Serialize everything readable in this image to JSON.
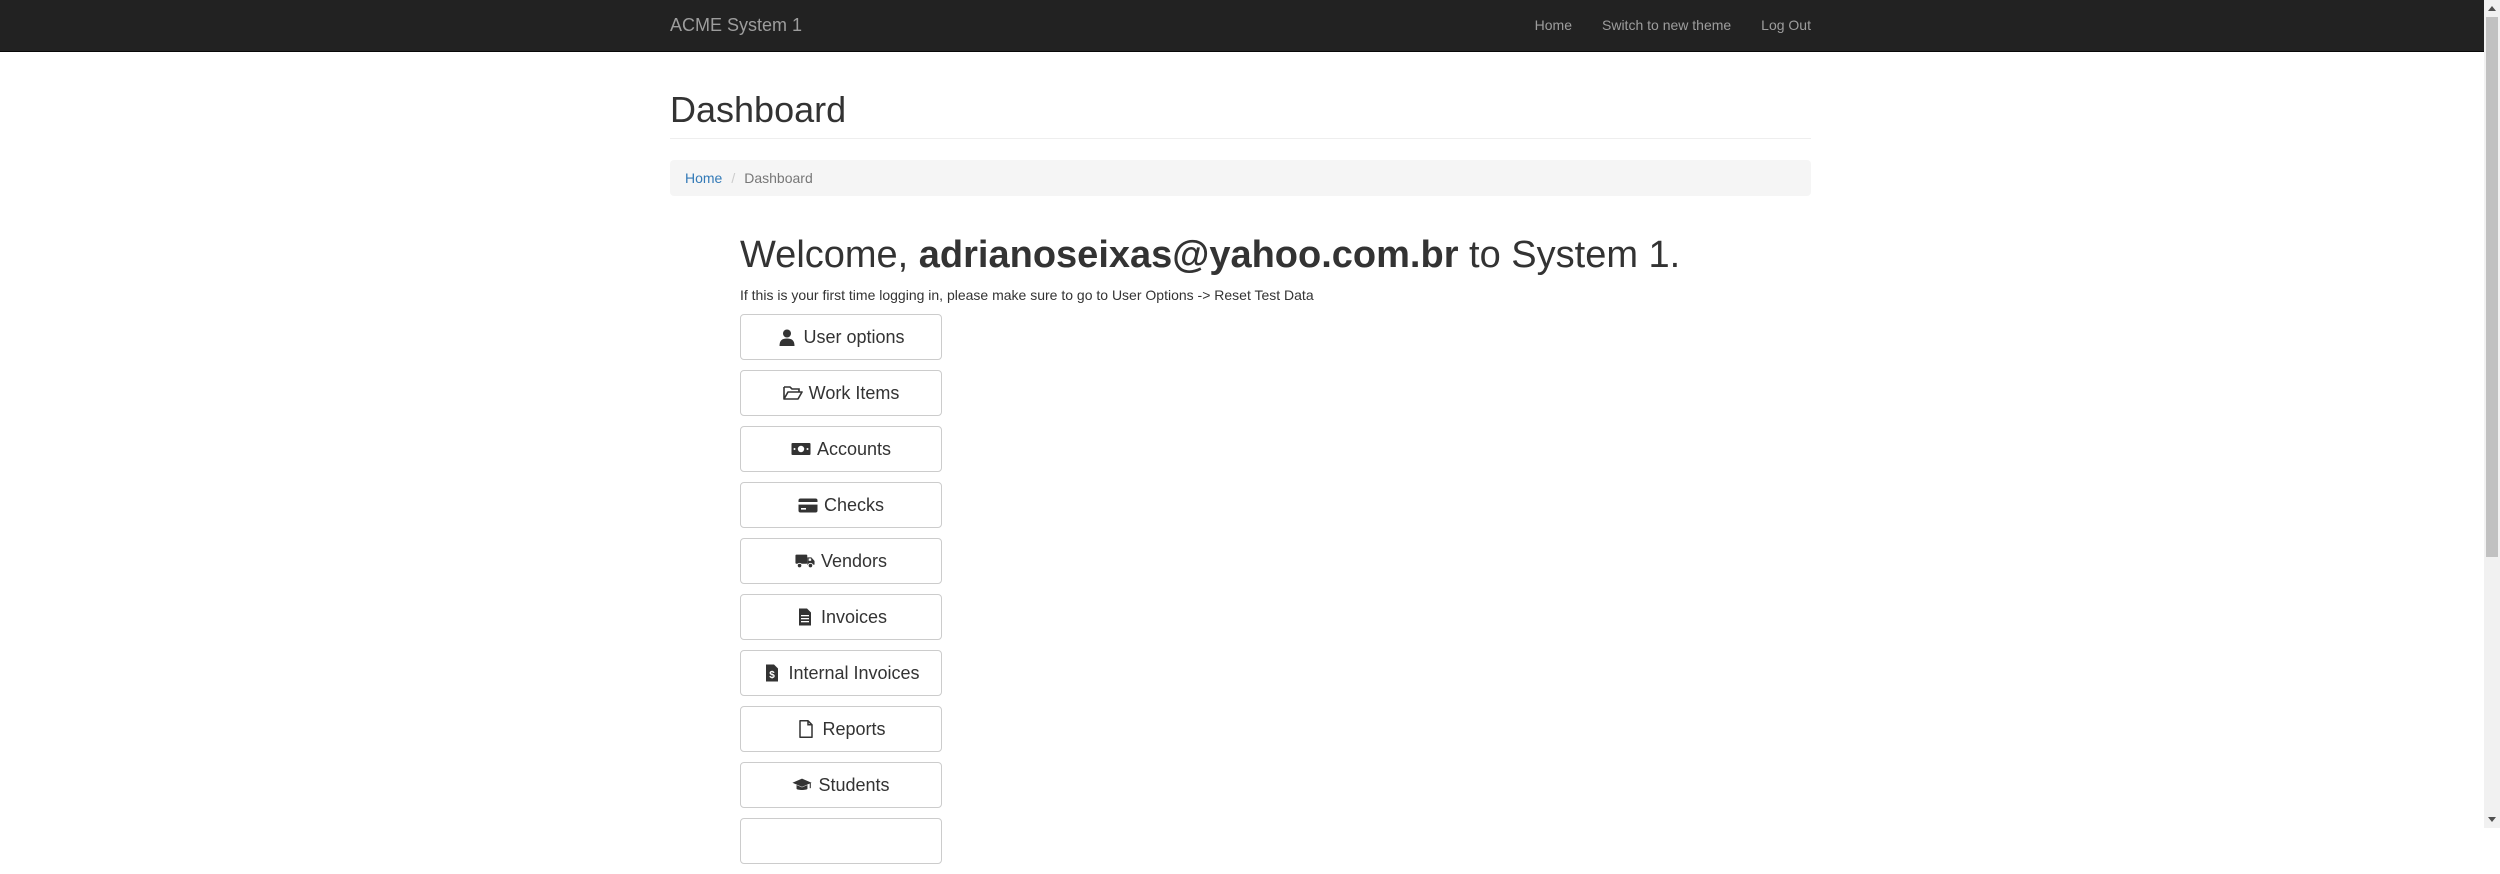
{
  "navbar": {
    "brand": "ACME System 1",
    "links": [
      "Home",
      "Switch to new theme",
      "Log Out"
    ]
  },
  "page": {
    "title": "Dashboard"
  },
  "breadcrumb": {
    "home": "Home",
    "separator": "/",
    "current": "Dashboard"
  },
  "welcome": {
    "prefix": "Welcome, ",
    "email": "adrianoseixas@yahoo.com.br",
    "suffix": " to System 1."
  },
  "note": "If this is your first time logging in, please make sure to go to User Options -> Reset Test Data",
  "menu": [
    {
      "label": "User options",
      "icon": "user-icon"
    },
    {
      "label": "Work Items",
      "icon": "folder-open-icon"
    },
    {
      "label": "Accounts",
      "icon": "money-icon"
    },
    {
      "label": "Checks",
      "icon": "credit-card-icon"
    },
    {
      "label": "Vendors",
      "icon": "truck-icon"
    },
    {
      "label": "Invoices",
      "icon": "file-text-icon"
    },
    {
      "label": "Internal Invoices",
      "icon": "file-invoice-icon"
    },
    {
      "label": "Reports",
      "icon": "file-icon"
    },
    {
      "label": "Students",
      "icon": "graduation-cap-icon"
    }
  ],
  "colors": {
    "navbar_bg": "#222222",
    "navbar_text": "#9d9d9d",
    "link": "#337ab7",
    "breadcrumb_bg": "#f5f5f5"
  }
}
